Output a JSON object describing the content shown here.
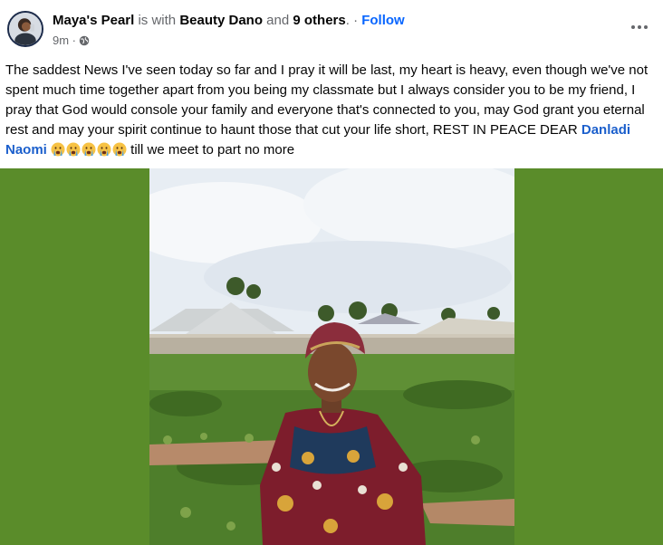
{
  "post": {
    "author": "Maya's Pearl",
    "with_text": " is with ",
    "tagged_person": "Beauty Dano",
    "and_text": " and ",
    "others": "9 others",
    "separator": ". · ",
    "follow": "Follow",
    "time": "9m ·",
    "privacy_icon": "globe-icon",
    "more_icon": "more-options-icon",
    "text_before_mention": "The saddest News I've seen today so far and I pray it will be last, my heart is heavy, even though we've not spent much time together apart from you being my classmate but I always consider you to be my friend, I pray that God would console your family and everyone that's connected to you, may God grant you eternal rest and may your spirit continue to haunt those that cut your life short, REST IN PEACE DEAR ",
    "mention": "Danladi Naomi",
    "emoji_icons": [
      "crying-face-icon",
      "crying-face-icon",
      "crying-face-icon",
      "crying-face-icon",
      "crying-face-icon"
    ],
    "text_after_mention": " till we meet to part no more"
  },
  "colors": {
    "link_blue": "#0866ff",
    "mention_blue": "#1b5fcc",
    "photo_background_green": "#5a8c2a",
    "muted_gray": "#65676b"
  }
}
